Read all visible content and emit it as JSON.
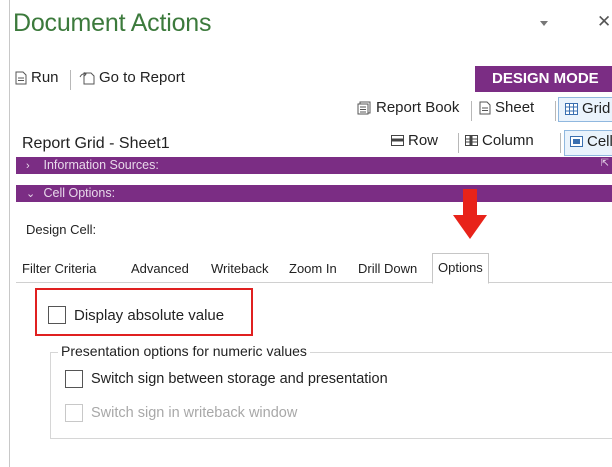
{
  "pane": {
    "title": "Document Actions",
    "dropdown_icon": "caret-down-icon",
    "close_icon": "close-icon"
  },
  "toolbar": {
    "run_label": "Run",
    "go_to_report_label": "Go to Report",
    "design_mode_label": "DESIGN MODE"
  },
  "view_switch": {
    "report_book_label": "Report Book",
    "sheet_label": "Sheet",
    "grid_label": "Grid",
    "selected": "Grid"
  },
  "grid_bar": {
    "title": "Report Grid - Sheet1",
    "row_label": "Row",
    "column_label": "Column",
    "cell_label": "Cell",
    "selected": "Cell"
  },
  "sections": {
    "information_sources": "Information Sources:",
    "cell_options": "Cell Options:"
  },
  "design_cell_label": "Design Cell:",
  "tabs": [
    {
      "label": "Filter Criteria",
      "active": false
    },
    {
      "label": "Advanced",
      "active": false
    },
    {
      "label": "Writeback",
      "active": false
    },
    {
      "label": "Zoom In",
      "active": false
    },
    {
      "label": "Drill Down",
      "active": false
    },
    {
      "label": "Options",
      "active": true
    }
  ],
  "options": {
    "display_absolute_value": {
      "label": "Display absolute value",
      "checked": false
    },
    "group_legend": "Presentation options for numeric values",
    "switch_sign_storage": {
      "label": "Switch sign between storage and presentation",
      "checked": false,
      "enabled": true
    },
    "switch_sign_writeback": {
      "label": "Switch sign in writeback window",
      "checked": false,
      "enabled": false
    }
  },
  "colors": {
    "title_green": "#3c7a3c",
    "purple": "#7b2d84",
    "highlight_red": "#e02020",
    "arrow_red": "#e8231a"
  }
}
